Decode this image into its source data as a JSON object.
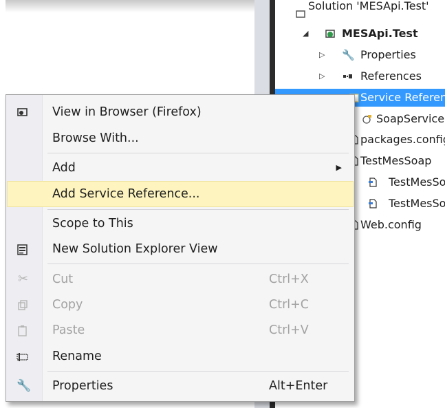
{
  "tree": {
    "items": [
      {
        "label": "Solution 'MESApi.Test'",
        "icon": "solution-icon",
        "bold": false
      },
      {
        "label": "MESApi.Test",
        "icon": "web-project-icon",
        "bold": true
      },
      {
        "label": "Properties",
        "icon": "wrench-icon",
        "bold": false
      },
      {
        "label": "References",
        "icon": "references-icon",
        "bold": false
      },
      {
        "label": "Service References",
        "icon": "service-reference-folder-icon",
        "bold": false
      },
      {
        "label": "SoapService",
        "icon": "soap-service-icon",
        "bold": false
      },
      {
        "label": "packages.config",
        "icon": "file-icon",
        "bold": false
      },
      {
        "label": "TestMesSoap",
        "icon": "file-icon",
        "bold": false
      },
      {
        "label": "TestMesSoap",
        "icon": "cs-file-icon",
        "bold": false
      },
      {
        "label": "TestMesSoap",
        "icon": "cs-file-icon",
        "bold": false
      },
      {
        "label": "Web.config",
        "icon": "file-icon",
        "bold": false
      }
    ]
  },
  "menu": {
    "items": [
      {
        "label": "View in Browser (Firefox)",
        "icon": "browser-icon",
        "shortcut": ""
      },
      {
        "label": "Browse With...",
        "icon": "",
        "shortcut": ""
      },
      {
        "label": "Add",
        "icon": "",
        "shortcut": "",
        "submenu": true
      },
      {
        "label": "Add Service Reference...",
        "icon": "",
        "shortcut": ""
      },
      {
        "label": "Scope to This",
        "icon": "",
        "shortcut": ""
      },
      {
        "label": "New Solution Explorer View",
        "icon": "new-view-icon",
        "shortcut": ""
      },
      {
        "label": "Cut",
        "icon": "scissors-icon",
        "shortcut": "Ctrl+X",
        "disabled": true
      },
      {
        "label": "Copy",
        "icon": "copy-icon",
        "shortcut": "Ctrl+C",
        "disabled": true
      },
      {
        "label": "Paste",
        "icon": "paste-icon",
        "shortcut": "Ctrl+V",
        "disabled": true
      },
      {
        "label": "Rename",
        "icon": "rename-icon",
        "shortcut": ""
      },
      {
        "label": "Properties",
        "icon": "wrench-icon",
        "shortcut": "Alt+Enter"
      }
    ],
    "submenu_arrow": "▶"
  },
  "colors": {
    "selection": "#3399ff",
    "highlight": "#fdf4bf",
    "menu_bg": "#f5f5f5"
  }
}
